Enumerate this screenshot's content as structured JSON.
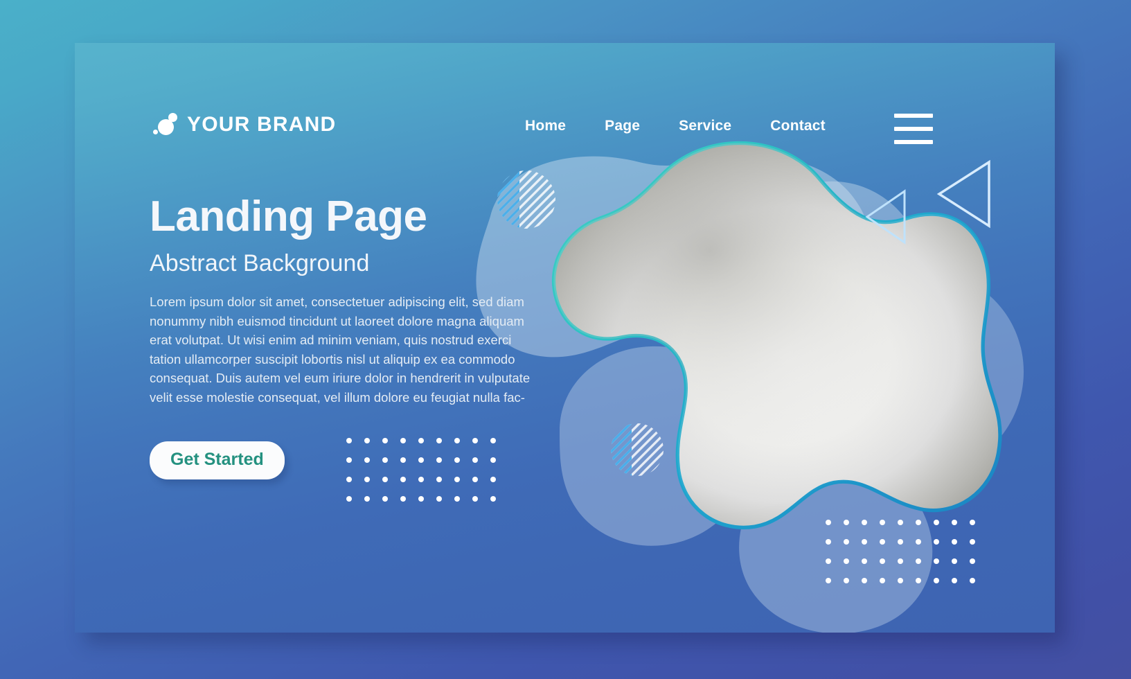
{
  "header": {
    "brand_name": "YOUR BRAND",
    "logo_icon": "brand-bubbles-icon",
    "menu_icon": "hamburger-menu-icon",
    "nav": [
      {
        "label": "Home"
      },
      {
        "label": "Page"
      },
      {
        "label": "Service"
      },
      {
        "label": "Contact"
      }
    ]
  },
  "hero": {
    "headline": "Landing Page",
    "subheadline": "Abstract Background",
    "body": "Lorem ipsum dolor sit amet, consectetuer adipiscing elit, sed diam nonummy nibh euismod tincidunt ut laoreet dolore magna aliquam erat volutpat. Ut wisi enim ad minim veniam, quis nostrud exerci tation ullamcorper suscipit lobortis nisl ut aliquip ex ea commodo consequat. Duis autem vel eum iriure dolor in hendrerit in vulputate velit esse molestie consequat, vel illum dolore eu feugiat nulla fac-",
    "cta_label": "Get Started"
  },
  "decor": {
    "blob_outline_color_start": "#2fc9c2",
    "blob_outline_color_end": "#1b86c4",
    "blob_fill_light": "#e9eaea",
    "blob_fill_shadow": "#9c9c99",
    "overlay_blob_color": "#cfe0ef",
    "striped_circle_color": "#ffffff",
    "striped_circle_accent": "#2fa3e8",
    "triangle_stroke_color": "#bfe2fb",
    "dot_color": "#ffffff",
    "shapes": [
      {
        "name": "striped-circle-top",
        "type": "striped-circle"
      },
      {
        "name": "striped-circle-bottom",
        "type": "striped-circle"
      },
      {
        "name": "triangle-small",
        "type": "triangle-outline"
      },
      {
        "name": "triangle-large",
        "type": "triangle-outline"
      },
      {
        "name": "dot-grid-left",
        "type": "dot-grid",
        "cols": 9,
        "rows": 4
      },
      {
        "name": "dot-grid-right",
        "type": "dot-grid",
        "cols": 9,
        "rows": 4
      }
    ]
  },
  "theme": {
    "page_bg_top": "#4ab0c9",
    "page_bg_bottom": "#4450a2",
    "card_bg_top": "#57b3cc",
    "card_bg_bottom": "#3e64b2",
    "cta_text_color": "#249180",
    "cta_bg_color": "#fbfcfd",
    "text_color": "#ffffff"
  }
}
